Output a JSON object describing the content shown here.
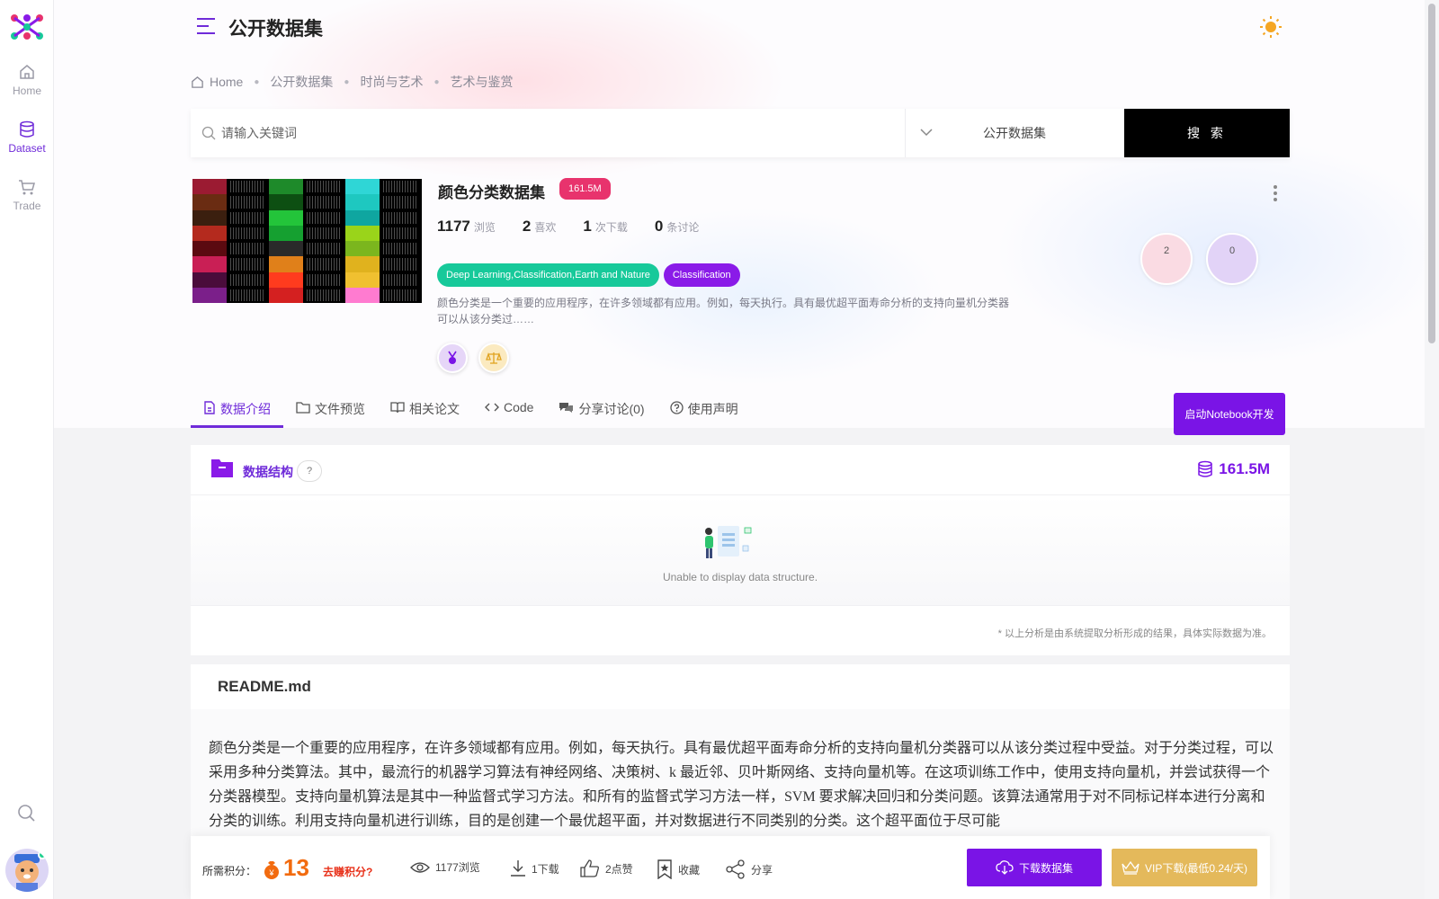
{
  "nav": {
    "items": [
      {
        "label": "Home"
      },
      {
        "label": "Dataset"
      },
      {
        "label": "Trade"
      }
    ]
  },
  "header": {
    "title": "公开数据集"
  },
  "breadcrumb": [
    "Home",
    "公开数据集",
    "时尚与艺术",
    "艺术与鉴赏"
  ],
  "search": {
    "placeholder": "请输入关键词",
    "scope": "公开数据集",
    "button": "搜 索"
  },
  "dataset": {
    "title": "颜色分类数据集",
    "size": "161.5M",
    "stats": [
      {
        "value": "1177",
        "unit": "浏览"
      },
      {
        "value": "2",
        "unit": "喜欢"
      },
      {
        "value": "1",
        "unit": "次下载"
      },
      {
        "value": "0",
        "unit": "条讨论"
      }
    ],
    "tags": [
      {
        "label": "Deep Learning,Classification,Earth and Nature",
        "color": "#17c99a"
      },
      {
        "label": "Classification",
        "color": "#8a1be8"
      }
    ],
    "description": "颜色分类是一个重要的应用程序，在许多领域都有应用。例如，每天执行。具有最优超平面寿命分析的支持向量机分类器可以从该分类过……",
    "circles": [
      {
        "value": "2",
        "color": "#fadbe3"
      },
      {
        "value": "0",
        "color": "#e2d3f7"
      }
    ]
  },
  "tabs": [
    {
      "label": "数据介绍",
      "icon": "file-icon",
      "active": true
    },
    {
      "label": "文件预览",
      "icon": "folder-icon"
    },
    {
      "label": "相关论文",
      "icon": "book-icon"
    },
    {
      "label": "Code",
      "icon": "code-icon"
    },
    {
      "label": "分享讨论(0)",
      "icon": "chat-icon"
    },
    {
      "label": "使用声明",
      "icon": "question-icon"
    }
  ],
  "notebook_button": "启动Notebook开发",
  "structure": {
    "title": "数据结构",
    "help": "?",
    "size": "161.5M",
    "empty_text": "Unable to display data structure.",
    "note": "* 以上分析是由系统提取分析形成的结果，具体实际数据为准。"
  },
  "readme": {
    "title": "README.md",
    "body": "颜色分类是一个重要的应用程序，在许多领域都有应用。例如，每天执行。具有最优超平面寿命分析的支持向量机分类器可以从该分类过程中受益。对于分类过程，可以采用多种分类算法。其中，最流行的机器学习算法有神经网络、决策树、k 最近邻、贝叶斯网络、支持向量机等。在这项训练工作中，使用支持向量机，并尝试获得一个分类器模型。支持向量机算法是其中一种监督式学习方法。和所有的监督式学习方法一样，SVM 要求解决回归和分类问题。该算法通常用于对不同标记样本进行分离和分类的训练。利用支持向量机进行训练，目的是创建一个最优超平面，并对数据进行不同类别的分类。这个超平面位于尽可能"
  },
  "actionbar": {
    "points_label": "所需积分：",
    "points": "13",
    "earn": "去赚积分?",
    "views": "1177浏览",
    "downloads": "1下载",
    "likes": "2点赞",
    "favorite": "收藏",
    "share": "分享",
    "download_button": "下载数据集",
    "vip_button": "VIP下载(最低0.24/天)"
  },
  "colors": {
    "accent": "#7a14e6",
    "badge": "#e8336d",
    "vip": "#e4b95b",
    "points": "#f26b0f"
  }
}
